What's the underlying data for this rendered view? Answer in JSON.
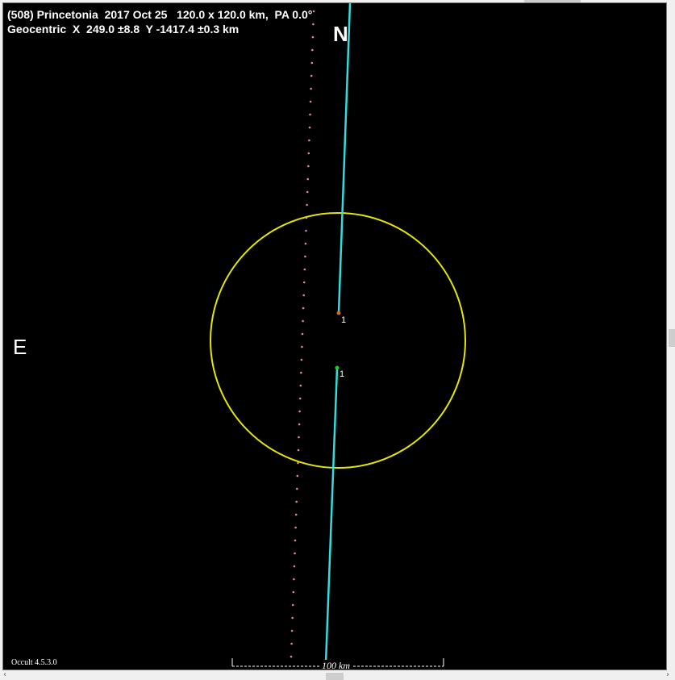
{
  "header": {
    "line1": "(508) Princetonia  2017 Oct 25   120.0 x 120.0 km,  PA 0.0°",
    "line2": "Geocentric  X  249.0 ±8.8  Y -1417.4 ±0.3 km"
  },
  "compass": {
    "north": "N",
    "east": "E"
  },
  "chords": [
    {
      "label": "1",
      "marker_color": "#d2691e"
    },
    {
      "label": "1",
      "marker_color": "#22cc22"
    }
  ],
  "footer": {
    "software": "Occult 4.5.3.0",
    "scale_label": "100 km"
  },
  "colors": {
    "background": "#000000",
    "ellipse": "#e6e600",
    "chord": "#33dddd",
    "dotted_path": "#d98aa0",
    "text": "#ffffff"
  },
  "icons": {
    "scroll_left": "chevron-left-icon",
    "scroll_right": "chevron-right-icon"
  }
}
